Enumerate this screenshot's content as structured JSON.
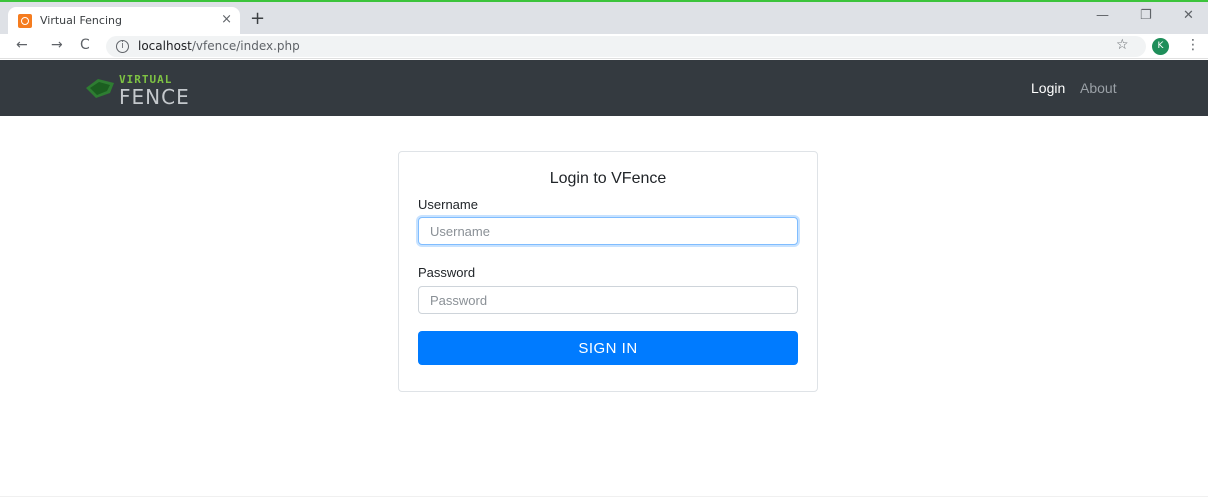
{
  "browser": {
    "tab_title": "Virtual Fencing",
    "tab_close": "×",
    "new_tab": "+",
    "url_host": "localhost",
    "url_path": "/vfence/index.php",
    "info_glyph": "i",
    "star_glyph": "☆",
    "profile_initial": "K",
    "menu_glyph": "⋮",
    "back_glyph": "←",
    "forward_glyph": "→",
    "reload_glyph": "C",
    "minimize_glyph": "—",
    "restore_glyph": "❐",
    "close_glyph": "✕",
    "icons": [
      "favicon-icon",
      "back-icon",
      "forward-icon",
      "reload-icon",
      "info-icon",
      "star-icon",
      "avatar",
      "menu-icon"
    ]
  },
  "navbar": {
    "logo_top": "VIRTUAL",
    "logo_bottom": "FENCE",
    "links": [
      {
        "label": "Login",
        "active": true
      },
      {
        "label": "About",
        "active": false
      }
    ]
  },
  "login": {
    "title": "Login to VFence",
    "username_label": "Username",
    "username_placeholder": "Username",
    "password_label": "Password",
    "password_placeholder": "Password",
    "submit_label": "SIGN IN"
  },
  "colors": {
    "navbar_bg": "#343a40",
    "primary": "#007bff",
    "logo_green": "#7ec243",
    "favicon_orange": "#f57c1f",
    "tab_accent": "#3cc43c"
  }
}
